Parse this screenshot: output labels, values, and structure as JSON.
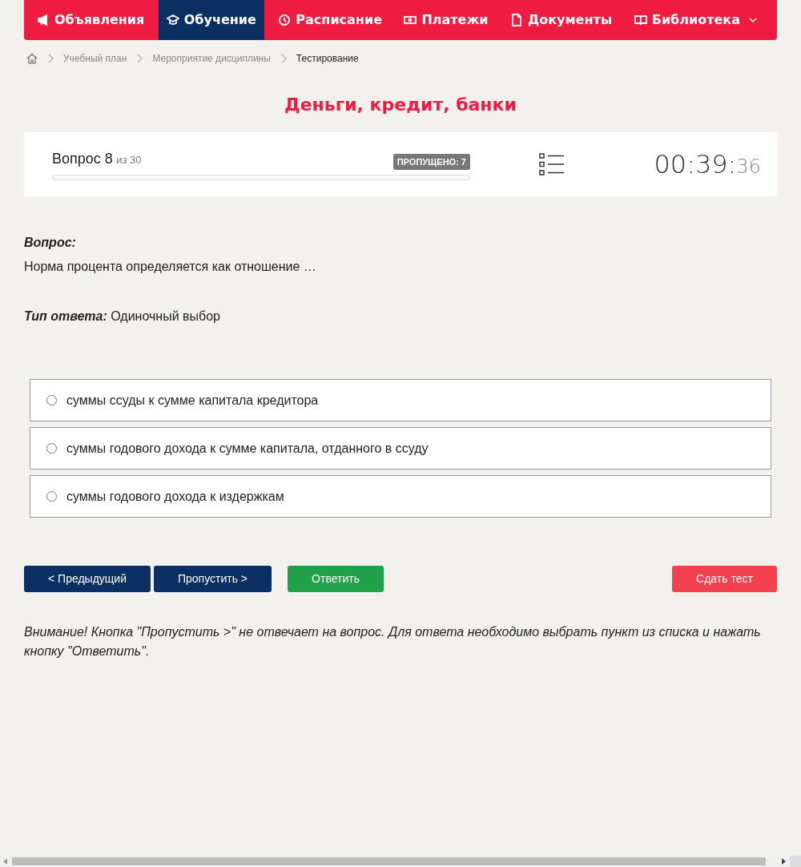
{
  "nav": {
    "items": [
      {
        "label": "Объявления",
        "kind": "link",
        "selected": false
      },
      {
        "label": "Обучение",
        "kind": "link",
        "selected": true
      },
      {
        "label": "Расписание",
        "kind": "link",
        "selected": false
      },
      {
        "label": "Платежи",
        "kind": "link",
        "selected": false
      },
      {
        "label": "Документы",
        "kind": "link",
        "selected": false
      },
      {
        "label": "Библиотека",
        "kind": "dropdown",
        "selected": false
      }
    ]
  },
  "breadcrumb": [
    "Учебный план",
    "Мероприятие дисциплины",
    "Тестирование"
  ],
  "title": "Деньги, кредит, банки",
  "progress": {
    "question": "Вопрос 8",
    "of": "из 30",
    "skipped": "ПРОПУЩЕНО: 7",
    "level": 0,
    "timer_main": "00:39:",
    "timer_seconds": "36"
  },
  "question": {
    "label": "Вопрос:",
    "text": "Норма процента определяется как отношение …",
    "type_label": "Тип ответа:",
    "type_value": "Одиночный выбор"
  },
  "options": [
    {
      "text": "суммы ссуды к сумме капитала кредитора",
      "selected": false
    },
    {
      "text": "суммы годового дохода к сумме капитала, отданного в ссуду",
      "selected": false
    },
    {
      "text": "суммы годового дохода к издержкам",
      "selected": false
    }
  ],
  "buttons": {
    "prev": "< Предыдущий",
    "skip": "Пропустить >",
    "answer": "Ответить",
    "submit": "Сдать тест"
  },
  "note": "Внимание! Кнопка \"Пропустить >\" не отвечает на вопрос. Для ответа необходимо выбрать пункт из списка и нажать кнопку \"Ответить\"."
}
